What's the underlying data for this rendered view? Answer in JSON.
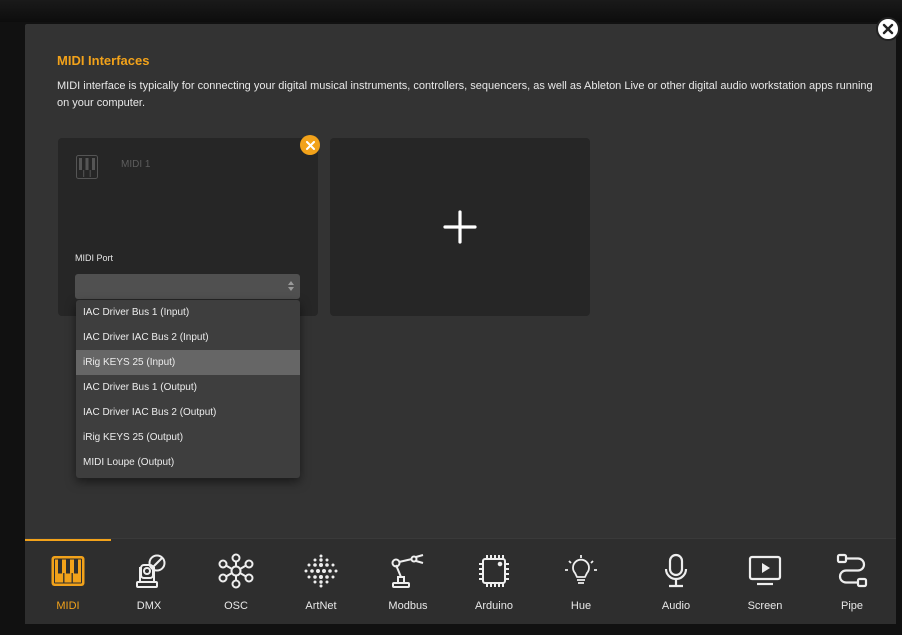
{
  "colors": {
    "accent": "#f2a21a",
    "modal_bg": "#333333",
    "card_bg": "#262626"
  },
  "header": {
    "title": "MIDI Interfaces",
    "description": "MIDI interface is typically for connecting your digital musical instruments, controllers, sequencers, as well as Ableton Live or other digital audio workstation apps running on your computer."
  },
  "close_icon": "close-icon",
  "card": {
    "name": "MIDI 1",
    "port_label": "MIDI Port",
    "port_value": "",
    "remove_icon": "remove-icon"
  },
  "add_card": {
    "icon": "plus-icon"
  },
  "dropdown": {
    "selected_index": 2,
    "options": [
      "IAC Driver Bus 1 (Input)",
      "IAC Driver IAC Bus 2 (Input)",
      "iRig KEYS 25 (Input)",
      "IAC Driver Bus 1 (Output)",
      "IAC Driver IAC Bus 2 (Output)",
      "iRig KEYS 25 (Output)",
      "MIDI Loupe (Output)"
    ]
  },
  "tabs": [
    {
      "label": "MIDI",
      "icon": "piano-keys-icon",
      "active": true
    },
    {
      "label": "DMX",
      "icon": "moving-light-icon",
      "active": false
    },
    {
      "label": "OSC",
      "icon": "network-nodes-icon",
      "active": false
    },
    {
      "label": "ArtNet",
      "icon": "dot-grid-icon",
      "active": false
    },
    {
      "label": "Modbus",
      "icon": "robot-arm-icon",
      "active": false
    },
    {
      "label": "Arduino",
      "icon": "chip-icon",
      "active": false
    },
    {
      "label": "Hue",
      "icon": "light-bulb-icon",
      "active": false
    },
    {
      "label": "Audio",
      "icon": "microphone-icon",
      "active": false
    },
    {
      "label": "Screen",
      "icon": "screen-play-icon",
      "active": false
    },
    {
      "label": "Pipe",
      "icon": "pipe-icon",
      "active": false
    }
  ]
}
